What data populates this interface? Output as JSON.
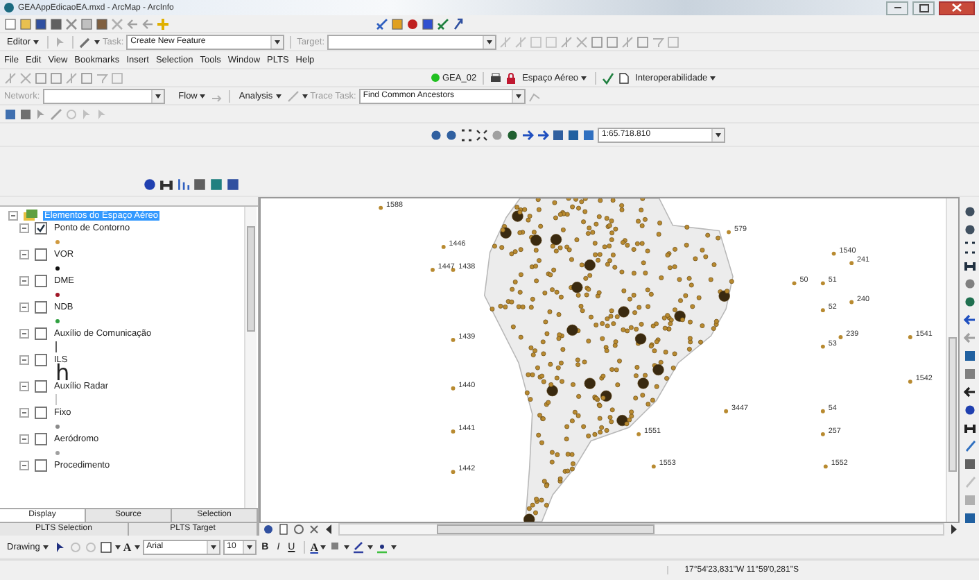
{
  "window": {
    "title": "GEAAppEdicaoEA.mxd - ArcMap - ArcInfo"
  },
  "editor_toolbar": {
    "menu": "Editor",
    "task_label": "Task:",
    "task_value": "Create New Feature",
    "target_label": "Target:"
  },
  "menu": [
    "File",
    "Edit",
    "View",
    "Bookmarks",
    "Insert",
    "Selection",
    "Tools",
    "Window",
    "PLTS",
    "Help"
  ],
  "plts_toolbar": {
    "database": "GEA_02",
    "menus": [
      "Espaço Aéreo",
      "Interoperabilidade"
    ]
  },
  "network_toolbar": {
    "network_label": "Network:",
    "menus": [
      "Flow",
      "Analysis"
    ],
    "trace_task_label": "Trace Task:",
    "trace_task_value": "Find Common Ancestors"
  },
  "scale": "1:65.718.810",
  "toc": {
    "label": "Elementos do Espaço Aéreo",
    "selected": true,
    "expanded": true,
    "children": [
      {
        "label": "Ponto de Contorno",
        "checked": true,
        "expanded": true,
        "symbol": {
          "kind": "dot",
          "color": "#d09a40"
        }
      },
      {
        "label": "VOR",
        "checked": false,
        "expanded": true,
        "symbol": {
          "kind": "dot",
          "color": "#101010"
        }
      },
      {
        "label": "DME",
        "checked": false,
        "expanded": true,
        "symbol": {
          "kind": "dot",
          "color": "#a01828"
        }
      },
      {
        "label": "NDB",
        "checked": false,
        "expanded": true,
        "symbol": {
          "kind": "dot",
          "color": "#30a040"
        }
      },
      {
        "label": "Auxílio de Comunicação",
        "checked": false,
        "expanded": true,
        "symbol": {
          "kind": "line",
          "color": "#606060"
        }
      },
      {
        "label": "ILS",
        "checked": false,
        "expanded": true,
        "symbol": {
          "kind": "glyph",
          "text": "h"
        }
      },
      {
        "label": "Auxílio Radar",
        "checked": false,
        "expanded": true,
        "symbol": {
          "kind": "line",
          "color": "#c8c8c8"
        }
      },
      {
        "label": "Fixo",
        "checked": false,
        "expanded": true,
        "symbol": {
          "kind": "dot",
          "color": "#8a8a8a"
        }
      },
      {
        "label": "Aeródromo",
        "checked": false,
        "expanded": true,
        "symbol": {
          "kind": "dot",
          "color": "#a0a0a0"
        }
      },
      {
        "label": "Procedimento",
        "checked": false,
        "expanded": true
      }
    ]
  },
  "toc_tabs": [
    {
      "label": "Display",
      "selected": true
    },
    {
      "label": "Source",
      "selected": false
    },
    {
      "label": "Selection",
      "selected": false
    }
  ],
  "toc_tabs_2": [
    {
      "label": "PLTS Selection",
      "selected": false
    },
    {
      "label": "PLTS Target",
      "selected": false
    }
  ],
  "map": {
    "point_labels": [
      "1588",
      "1446",
      "1447",
      "1438",
      "1439",
      "1440",
      "1441",
      "1442",
      "579",
      "1540",
      "241",
      "50",
      "51",
      "240",
      "52",
      "239",
      "1541",
      "53",
      "1542",
      "3447",
      "54",
      "1551",
      "257",
      "1553",
      "1552"
    ]
  },
  "drawing_toolbar": {
    "menu": "Drawing",
    "font": "Arial",
    "size": "10",
    "bold": "B",
    "italic": "I",
    "underline": "U",
    "text_tool": "A",
    "font_color": "A"
  },
  "status_bar": {
    "coordinates": "17°54'23,831\"W 11°59'0,281\"S"
  }
}
